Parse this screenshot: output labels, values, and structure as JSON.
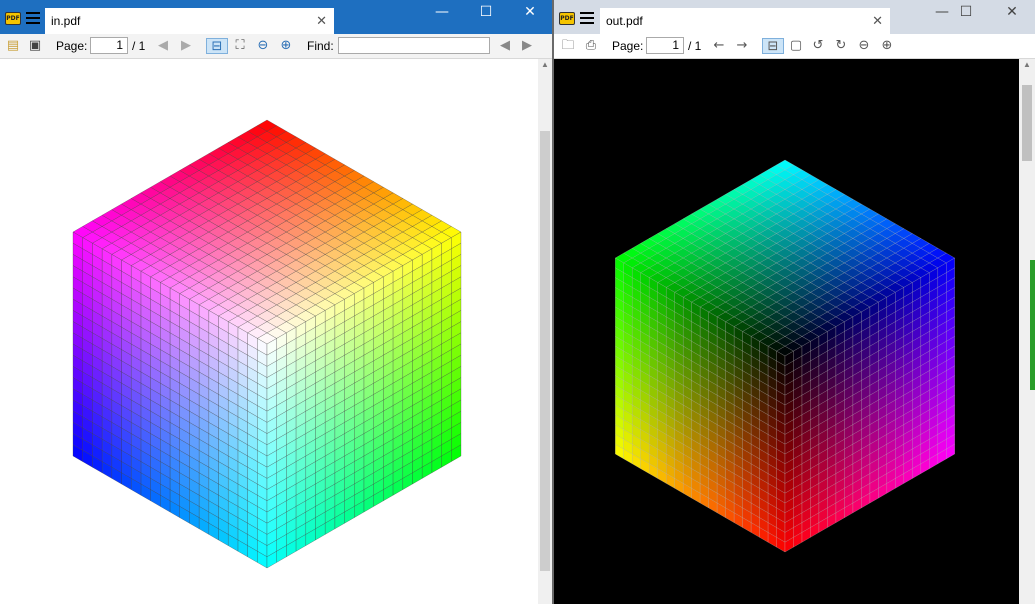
{
  "left_window": {
    "tab_title": "in.pdf",
    "tab_close": "✕",
    "controls": {
      "minimize": "—",
      "maximize": "☐",
      "close": "✕"
    },
    "toolbar": {
      "page_label": "Page:",
      "page_value": "1",
      "page_total": "/ 1",
      "find_label": "Find:",
      "find_value": ""
    },
    "cube_colors": {
      "top": "#ff0000",
      "left_top": "#ff00ff",
      "right_top": "#ffff00",
      "left_bottom": "#0000ff",
      "right_bottom": "#00ff00",
      "bottom": "#00ffff",
      "center": "#ffffff"
    }
  },
  "right_window": {
    "tab_title": "out.pdf",
    "tab_close": "✕",
    "controls": {
      "minimize": "—",
      "maximize": "☐",
      "close": "✕"
    },
    "toolbar": {
      "page_label": "Page:",
      "page_value": "1",
      "page_total": "/ 1"
    },
    "cube_colors": {
      "top": "#00ffff",
      "left_top": "#00ff00",
      "right_top": "#0000ff",
      "left_bottom": "#ffff00",
      "right_bottom": "#ff00ff",
      "bottom": "#ff0000",
      "center": "#000000"
    }
  },
  "icons": [
    "pdf-app-icon",
    "hamburger-menu-icon",
    "open-file-icon",
    "print-icon",
    "prev-page-icon",
    "next-page-icon",
    "fit-width-icon",
    "fit-page-icon",
    "rotate-left-icon",
    "rotate-right-icon",
    "zoom-out-icon",
    "zoom-in-icon",
    "find-prev-icon",
    "find-next-icon"
  ]
}
